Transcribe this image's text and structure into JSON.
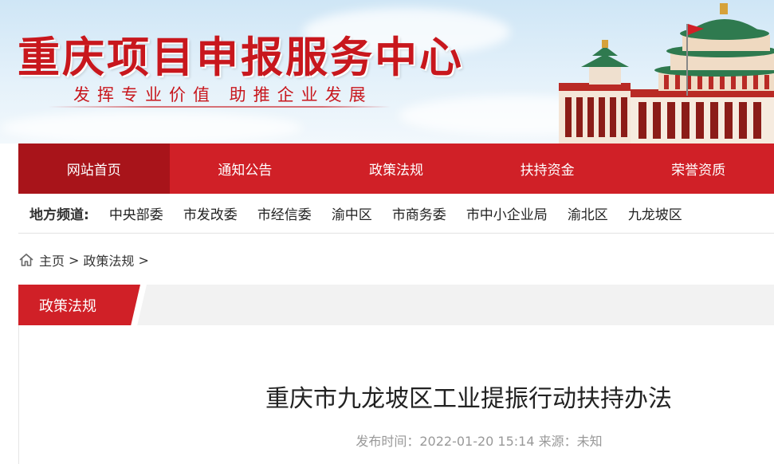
{
  "header": {
    "site_title": "重庆项目申报服务中心",
    "slogan": "发挥专业价值  助推企业发展"
  },
  "main_nav": {
    "items": [
      {
        "label": "网站首页",
        "active": true
      },
      {
        "label": "通知公告",
        "active": false
      },
      {
        "label": "政策法规",
        "active": false
      },
      {
        "label": "扶持资金",
        "active": false
      },
      {
        "label": "荣誉资质",
        "active": false
      }
    ]
  },
  "local_channels": {
    "label": "地方频道:",
    "links": [
      "中央部委",
      "市发改委",
      "市经信委",
      "渝中区",
      "市商务委",
      "市中小企业局",
      "渝北区",
      "九龙坡区"
    ]
  },
  "breadcrumb": {
    "home_icon": "home-icon",
    "items": [
      "主页",
      "政策法规"
    ],
    "separator": ">"
  },
  "section": {
    "title": "政策法规"
  },
  "article": {
    "title": "重庆市九龙坡区工业提振行动扶持办法",
    "meta": "发布时间：2022-01-20 15:14 来源：未知"
  },
  "colors": {
    "brand_red": "#d02027",
    "active_nav": "#a8141a"
  }
}
